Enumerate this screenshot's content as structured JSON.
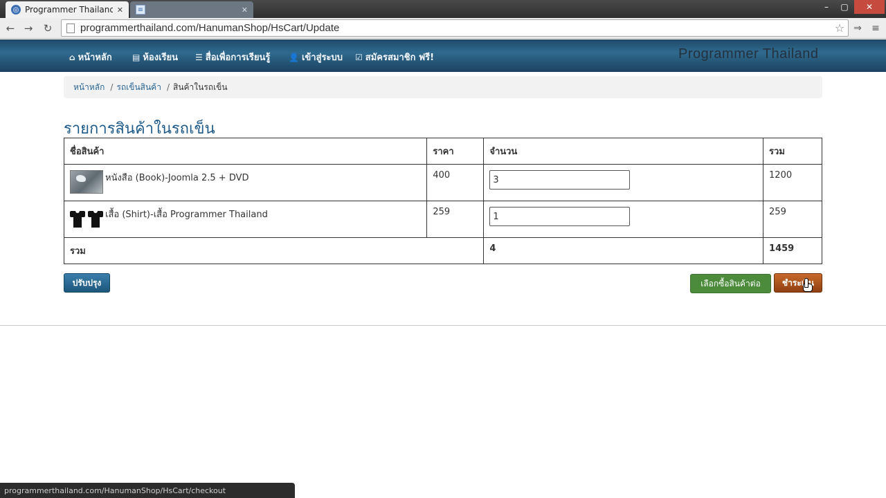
{
  "browser": {
    "tabs": [
      {
        "title": "Programmer Thailand - U|",
        "active": true
      },
      {
        "title": "",
        "active": false
      }
    ],
    "url": "programmerthailand.com/HanumanShop/HsCart/Update",
    "window_controls": {
      "minimize": "–",
      "maximize": "▢",
      "close": "✕"
    }
  },
  "navbar": {
    "items": [
      {
        "label": "หน้าหลัก",
        "icon": "home-icon"
      },
      {
        "label": "ห้องเรียน",
        "icon": "book-icon"
      },
      {
        "label": "สื่อเพื่อการเรียนรู้",
        "icon": "list-icon"
      },
      {
        "label": "เข้าสู่ระบบ",
        "icon": "user-icon"
      },
      {
        "label": "สมัครสมาชิก ฟรี!",
        "icon": "check-icon"
      }
    ],
    "brand": "Programmer Thailand"
  },
  "breadcrumb": {
    "items": [
      "หน้าหลัก",
      "รถเข็นสินค้า",
      "สินค้าในรถเข็น"
    ],
    "separator": "/"
  },
  "page": {
    "title": "รายการสินค้าในรถเข็น"
  },
  "cart": {
    "headers": {
      "name": "ชื่อสินค้า",
      "price": "ราคา",
      "qty": "จำนวน",
      "sum": "รวม"
    },
    "items": [
      {
        "name": "หนังสือ (Book)-Joomla 2.5 + DVD",
        "price": "400",
        "qty": "3",
        "sum": "1200",
        "image": "book-thumbnail"
      },
      {
        "name": "เสื้อ (Shirt)-เสื้อ Programmer Thailand",
        "price": "259",
        "qty": "1",
        "sum": "259",
        "image": "shirt-thumbnail"
      }
    ],
    "total": {
      "label": "รวม",
      "qty": "4",
      "sum": "1459"
    }
  },
  "buttons": {
    "update": "ปรับปรุง",
    "continue_shopping": "เลือกซื้อสินค้าต่อ",
    "checkout": "ชำระเงิน"
  },
  "status_bar": {
    "text": "programmerthailand.com/HanumanShop/HsCart/checkout"
  },
  "colors": {
    "navbar": "#2f6a8e",
    "link": "#2a6496",
    "heading": "#1e5a8a",
    "continue_button": "#4b8b3b",
    "checkout_button": "#b35a1f",
    "update_button": "#2a6a95"
  }
}
